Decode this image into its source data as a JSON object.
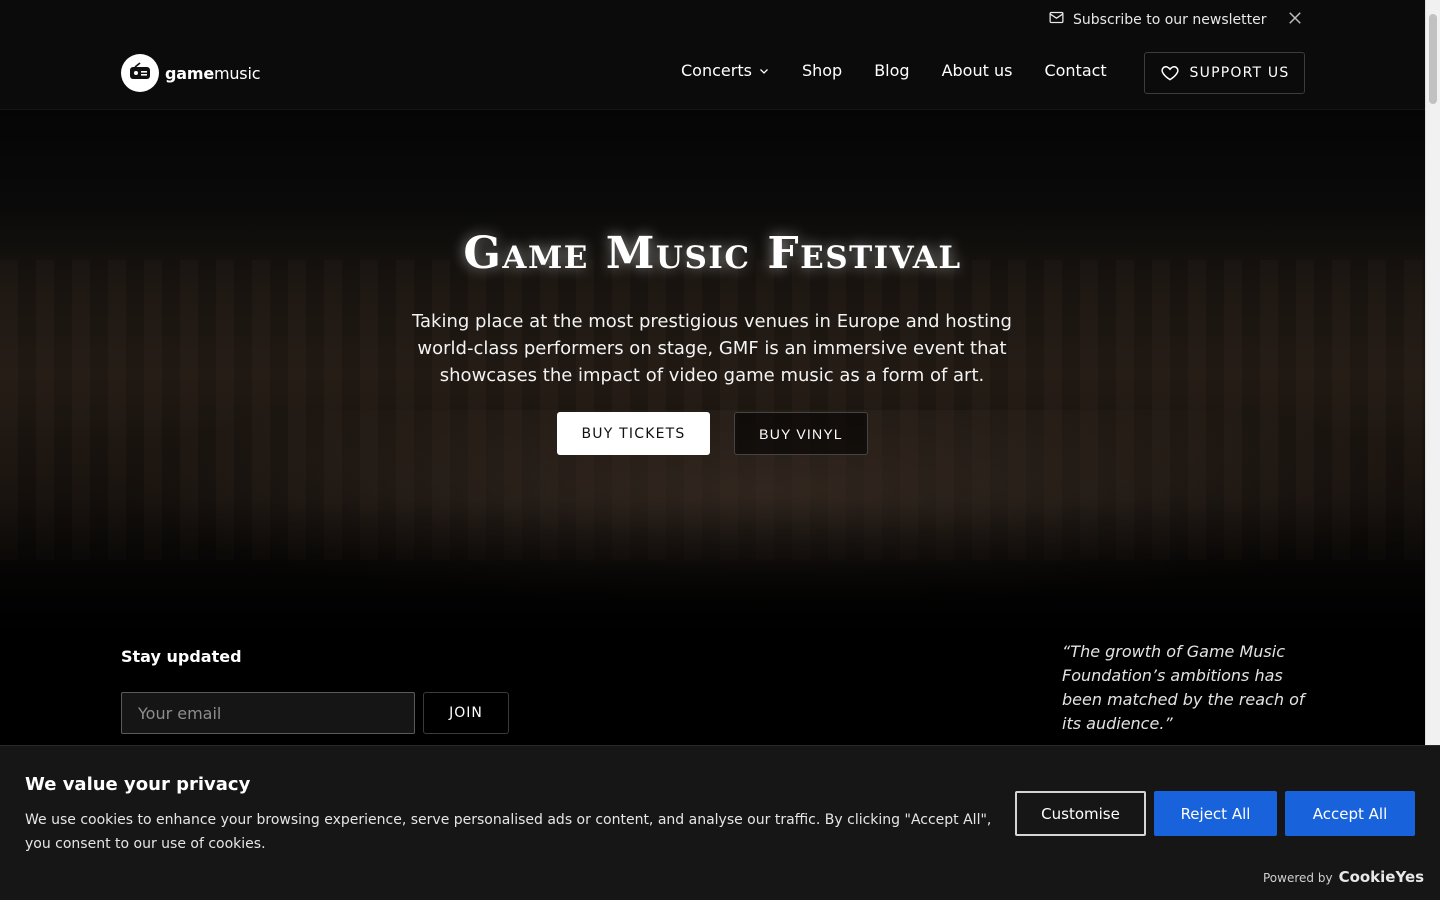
{
  "topbar": {
    "newsletter_label": "Subscribe to our newsletter",
    "close_icon": "close-icon",
    "mail_icon": "mail-icon"
  },
  "header": {
    "logo_text_bold": "game",
    "logo_text_light": "music",
    "nav": [
      {
        "label": "Concerts",
        "has_dropdown": true
      },
      {
        "label": "Shop"
      },
      {
        "label": "Blog"
      },
      {
        "label": "About us"
      },
      {
        "label": "Contact"
      }
    ],
    "support_label": "SUPPORT US",
    "support_icon": "heart-icon"
  },
  "hero": {
    "title": "Game Music Festival",
    "description": "Taking place at the most prestigious venues in Europe and hosting world-class performers on stage, GMF is an immersive event that showcases the impact of video game music as a form of art.",
    "buy_tickets": "BUY TICKETS",
    "buy_vinyl": "BUY VINYL"
  },
  "stay_updated": {
    "title": "Stay updated",
    "email_placeholder": "Your email",
    "join_label": "JOIN"
  },
  "quote": "“The growth of Game Music Foundation’s ambitions has been matched by the reach of its audience.”",
  "cookie": {
    "title": "We value your privacy",
    "text": "We use cookies to enhance your browsing experience, serve personalised ads or content, and analyse our traffic. By clicking \"Accept All\", you consent to our use of cookies.",
    "customise": "Customise",
    "reject_all": "Reject All",
    "accept_all": "Accept All",
    "powered_by": "Powered by",
    "powered_brand": "CookieYes"
  },
  "colors": {
    "accent_blue": "#1863dc",
    "background": "#000000",
    "header_bg": "#0b0b0b"
  }
}
